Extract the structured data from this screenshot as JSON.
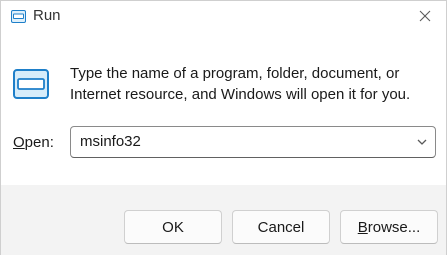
{
  "window": {
    "title": "Run",
    "icon": "run-icon",
    "close_icon": "close-icon"
  },
  "message": {
    "line1": "Type the name of a program, folder, document, or",
    "line2": "Internet resource, and Windows will open it for you."
  },
  "open_field": {
    "label_accel": "O",
    "label_rest": "pen:",
    "value": "msinfo32",
    "dropdown_icon": "chevron-down-icon"
  },
  "buttons": {
    "ok": "OK",
    "cancel": "Cancel",
    "browse_accel": "B",
    "browse_rest": "rowse..."
  },
  "colors": {
    "accent": "#0078d4",
    "footer_bg": "#f3f3f3"
  }
}
